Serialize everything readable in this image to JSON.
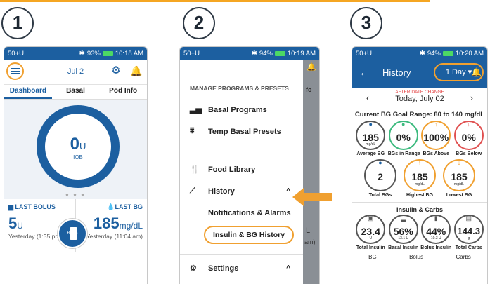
{
  "steps": [
    "1",
    "2",
    "3"
  ],
  "status1": {
    "left": "50+U",
    "right": "93%",
    "time": "10:18 AM"
  },
  "status2": {
    "left": "50+U",
    "right": "94%",
    "time": "10:19 AM"
  },
  "status3": {
    "left": "50+U",
    "right": "94%",
    "time": "10:20 AM"
  },
  "home": {
    "date": "Jul 2",
    "tabs": [
      "Dashboard",
      "Basal",
      "Pod Info"
    ],
    "iob_value": "0",
    "iob_unit": "U",
    "iob_label": "IOB",
    "last_bolus_label": "LAST BOLUS",
    "last_bolus_value": "5",
    "last_bolus_unit": "U",
    "last_bolus_time": "Yesterday (1:35 pm)",
    "last_bg_label": "LAST BG",
    "last_bg_value": "185",
    "last_bg_unit": "mg/dL",
    "last_bg_time": "Yesterday (11:04 am)",
    "bolus_button": "Bolus"
  },
  "menu": {
    "section_title": "MANAGE PROGRAMS & PRESETS",
    "basal_programs": "Basal Programs",
    "temp_basal_presets": "Temp Basal Presets",
    "food_library": "Food Library",
    "history": "History",
    "notifications": "Notifications & Alarms",
    "insulin_bg_history": "Insulin & BG History",
    "settings": "Settings",
    "shade_text1": "fo",
    "shade_text2": "L",
    "shade_text3": "am)"
  },
  "history": {
    "title": "History",
    "day_selector": "1 Day",
    "after_date_change": "AFTER DATE CHANGE",
    "date": "Today, July 02",
    "goal_range": "Current BG Goal Range: 80 to 140 mg/dL",
    "bg_stats": [
      {
        "value": "185",
        "unit": "mg/dL",
        "label": "Average BG"
      },
      {
        "value": "0%",
        "unit": "",
        "label": "BGs in Range"
      },
      {
        "value": "100%",
        "unit": "",
        "label": "BGs Above"
      },
      {
        "value": "0%",
        "unit": "",
        "label": "BGs Below"
      }
    ],
    "bg_stats2": [
      {
        "value": "2",
        "unit": "",
        "label": "Total BGs"
      },
      {
        "value": "185",
        "unit": "mg/dL",
        "label": "Highest BG"
      },
      {
        "value": "185",
        "unit": "mg/dL",
        "label": "Lowest BG"
      }
    ],
    "insulin_title": "Insulin & Carbs",
    "insulin_stats": [
      {
        "value": "23.4",
        "unit": "U",
        "label": "Total Insulin"
      },
      {
        "value": "56%",
        "unit": "13.1 U",
        "label": "Basal Insulin"
      },
      {
        "value": "44%",
        "unit": "10.3 U",
        "label": "Bolus Insulin"
      },
      {
        "value": "144.3",
        "unit": "g",
        "label": "Total Carbs"
      }
    ],
    "footer": [
      "BG",
      "Bolus",
      "Carbs"
    ]
  },
  "colors": {
    "brand_blue": "#1c5fa0",
    "highlight_orange": "#f0a030"
  }
}
